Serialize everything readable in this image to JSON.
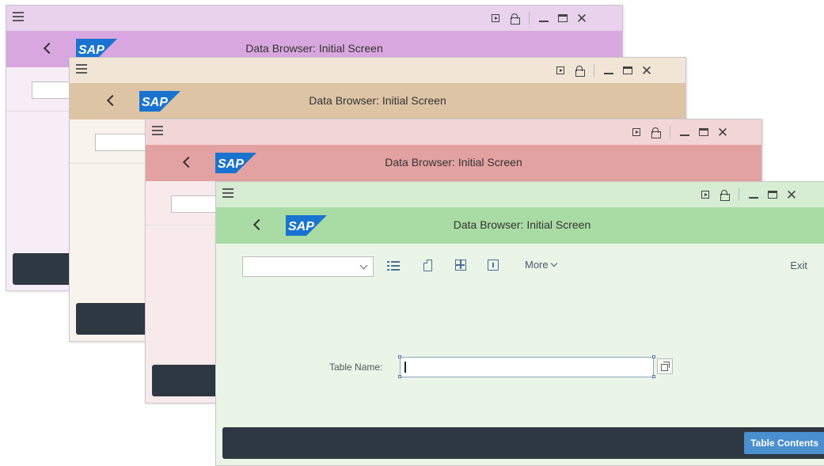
{
  "app": {
    "logo_text": "SAP"
  },
  "windows": [
    {
      "id": "purple",
      "title": "Data Browser: Initial Screen",
      "colors": {
        "titlebar": "#e8d2ec",
        "header": "#d9a7df",
        "body": "#f6edf7"
      }
    },
    {
      "id": "tan",
      "title": "Data Browser: Initial Screen",
      "colors": {
        "titlebar": "#f1e5d6",
        "header": "#ddc4a5",
        "body": "#f8f3ec"
      }
    },
    {
      "id": "red",
      "title": "Data Browser: Initial Screen",
      "colors": {
        "titlebar": "#f2d5d6",
        "header": "#e3a2a2",
        "body": "#f8eaeb"
      }
    },
    {
      "id": "green",
      "title": "Data Browser: Initial Screen",
      "colors": {
        "titlebar": "#d6ecd3",
        "header": "#a9dca4",
        "body": "#eaf5e8"
      }
    }
  ],
  "main": {
    "toolbar": {
      "combo_value": "",
      "icons": [
        "list-icon",
        "document-icon",
        "table-icon",
        "info-icon"
      ],
      "more_label": "More",
      "exit_label": "Exit"
    },
    "form": {
      "table_name_label": "Table Name:",
      "table_name_value": ""
    },
    "footer": {
      "table_contents_label": "Table Contents"
    }
  },
  "colors": {
    "sap_blue": "#1a73d0",
    "footer_bg": "#2e3843",
    "primary_button": "#4a8fd0"
  }
}
